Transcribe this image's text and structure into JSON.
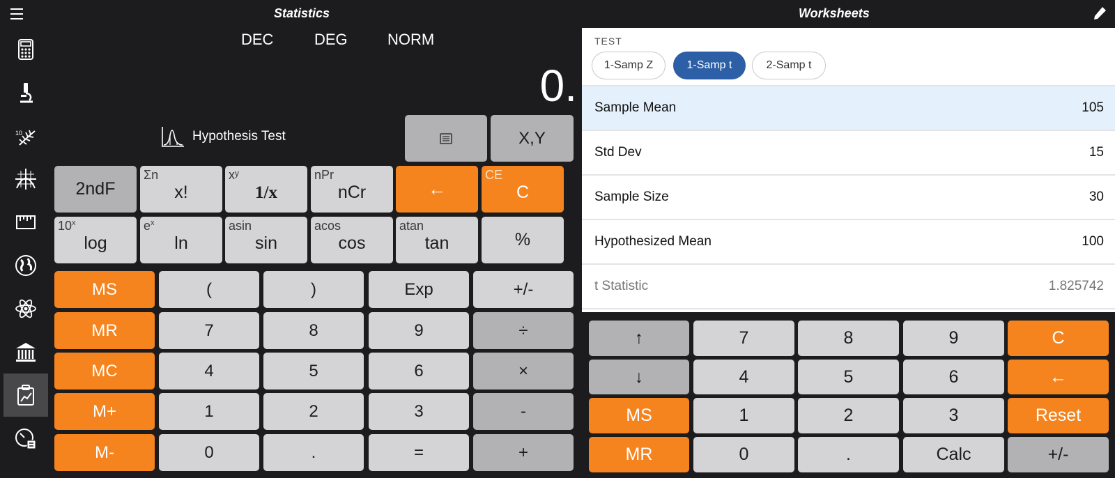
{
  "header": {
    "menu_icon": "hamburger-icon",
    "left_title": "Statistics",
    "right_title": "Worksheets",
    "edit_icon": "pencil-icon"
  },
  "sidebar": {
    "items": [
      {
        "icon": "calculator-icon"
      },
      {
        "icon": "microscope-icon"
      },
      {
        "icon": "fern-icon"
      },
      {
        "icon": "graph-icon"
      },
      {
        "icon": "ruler-icon"
      },
      {
        "icon": "globe-icon"
      },
      {
        "icon": "atom-icon"
      },
      {
        "icon": "bank-icon"
      },
      {
        "icon": "statistics-icon",
        "active": true
      },
      {
        "icon": "clock-calculator-icon"
      }
    ]
  },
  "calculator": {
    "modes": [
      "DEC",
      "DEG",
      "NORM"
    ],
    "display": "0.",
    "function_label": "Hypothesis Test",
    "list_icon": "list-icon",
    "xy_label": "X,Y",
    "row1": [
      {
        "main": "2ndF",
        "sup": ""
      },
      {
        "main": "x!",
        "sup": "Σn"
      },
      {
        "main": "1/x",
        "sup": "xʸ"
      },
      {
        "main": "nCr",
        "sup": "nPr"
      },
      {
        "main": "←",
        "sup": ""
      },
      {
        "main": "C",
        "sup": "CE"
      }
    ],
    "row2": [
      {
        "main": "log",
        "sup": "10",
        "supsup": "x"
      },
      {
        "main": "ln",
        "sup": "e",
        "supsup": "x"
      },
      {
        "main": "sin",
        "sup": "asin"
      },
      {
        "main": "cos",
        "sup": "acos"
      },
      {
        "main": "tan",
        "sup": "atan"
      },
      {
        "main": "%",
        "sup": ""
      }
    ],
    "memory": [
      "MS",
      "MR",
      "MC",
      "M+",
      "M-"
    ],
    "grid": [
      [
        "(",
        ")",
        "Exp",
        "+/-"
      ],
      [
        "7",
        "8",
        "9",
        "÷"
      ],
      [
        "4",
        "5",
        "6",
        "×"
      ],
      [
        "1",
        "2",
        "3",
        "-"
      ],
      [
        "0",
        ".",
        "=",
        "+"
      ]
    ]
  },
  "worksheet": {
    "section_label": "TEST",
    "tabs": [
      "1-Samp Z",
      "1-Samp t",
      "2-Samp t"
    ],
    "active_tab": "1-Samp t",
    "rows": [
      {
        "label": "Sample Mean",
        "value": "105"
      },
      {
        "label": "Std Dev",
        "value": "15"
      },
      {
        "label": "Sample Size",
        "value": "30"
      },
      {
        "label": "Hypothesized Mean",
        "value": "100"
      },
      {
        "label": "t Statistic",
        "value": "1.825742"
      }
    ]
  },
  "worksheet_pad": {
    "rows": [
      [
        "↑",
        "7",
        "8",
        "9",
        "C"
      ],
      [
        "↓",
        "4",
        "5",
        "6",
        "←"
      ],
      [
        "MS",
        "1",
        "2",
        "3",
        "Reset"
      ],
      [
        "MR",
        "0",
        ".",
        "Calc",
        "+/-"
      ]
    ]
  },
  "colors": {
    "accent_orange": "#f5841f",
    "accent_blue": "#2d5fa6",
    "key_light": "#d4d4d6",
    "key_gray": "#b2b2b5",
    "background": "#1c1c1e"
  }
}
